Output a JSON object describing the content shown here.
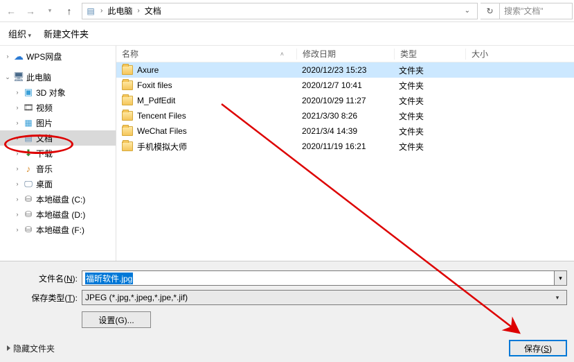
{
  "breadcrumb": {
    "parts": [
      "此电脑",
      "文档"
    ],
    "search_placeholder": "搜索\"文档\""
  },
  "toolbar": {
    "organize": "组织",
    "new_folder": "新建文件夹"
  },
  "sidebar": {
    "items": [
      {
        "label": "WPS网盘",
        "icon": "wps-icon",
        "arrow": ">"
      },
      {
        "label": "此电脑",
        "icon": "pc-icon",
        "arrow": "v"
      },
      {
        "label": "3D 对象",
        "icon": "3d-icon",
        "arrow": ">",
        "indent": true
      },
      {
        "label": "视频",
        "icon": "video-icon",
        "arrow": ">",
        "indent": true
      },
      {
        "label": "图片",
        "icon": "picture-icon",
        "arrow": ">",
        "indent": true
      },
      {
        "label": "文档",
        "icon": "document-icon",
        "arrow": ">",
        "indent": true,
        "selected": true,
        "annotated": true
      },
      {
        "label": "下载",
        "icon": "download-icon",
        "arrow": ">",
        "indent": true
      },
      {
        "label": "音乐",
        "icon": "music-icon",
        "arrow": ">",
        "indent": true
      },
      {
        "label": "桌面",
        "icon": "desktop-icon",
        "arrow": ">",
        "indent": true
      },
      {
        "label": "本地磁盘 (C:)",
        "icon": "disk-icon",
        "arrow": ">",
        "indent": true
      },
      {
        "label": "本地磁盘 (D:)",
        "icon": "disk-icon",
        "arrow": ">",
        "indent": true
      },
      {
        "label": "本地磁盘 (F:)",
        "icon": "disk-icon",
        "arrow": ">",
        "indent": true
      }
    ]
  },
  "filelist": {
    "headers": {
      "name": "名称",
      "date": "修改日期",
      "type": "类型",
      "size": "大小"
    },
    "rows": [
      {
        "name": "Axure",
        "date": "2020/12/23 15:23",
        "type": "文件夹",
        "selected": true
      },
      {
        "name": "Foxit files",
        "date": "2020/12/7 10:41",
        "type": "文件夹"
      },
      {
        "name": "M_PdfEdit",
        "date": "2020/10/29 11:27",
        "type": "文件夹"
      },
      {
        "name": "Tencent Files",
        "date": "2021/3/30 8:26",
        "type": "文件夹"
      },
      {
        "name": "WeChat Files",
        "date": "2021/3/4 14:39",
        "type": "文件夹"
      },
      {
        "name": "手机模拟大师",
        "date": "2020/11/19 16:21",
        "type": "文件夹"
      }
    ]
  },
  "form": {
    "filename_label": "文件名(N):",
    "filename_value": "福昕软件.jpg",
    "filetype_label": "保存类型(T):",
    "filetype_value": "JPEG (*.jpg,*.jpeg,*.jpe,*.jif)",
    "settings_label": "设置(G)...",
    "hide_folders": "隐藏文件夹",
    "save_label": "保存(S)"
  }
}
